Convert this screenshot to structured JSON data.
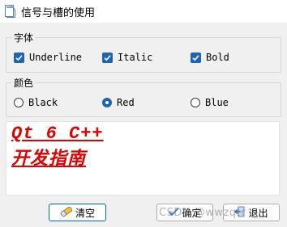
{
  "window": {
    "title": "信号与槽的使用"
  },
  "font_group": {
    "legend": "字体",
    "options": [
      {
        "label": "Underline",
        "checked": true
      },
      {
        "label": "Italic",
        "checked": true
      },
      {
        "label": "Bold",
        "checked": true
      }
    ]
  },
  "color_group": {
    "legend": "颜色",
    "options": [
      {
        "label": "Black",
        "selected": false
      },
      {
        "label": "Red",
        "selected": true
      },
      {
        "label": "Blue",
        "selected": false
      }
    ]
  },
  "editor": {
    "line1": "Qt 6 C++",
    "line2": "开发指南",
    "text_color": "#e00000"
  },
  "buttons": {
    "clear": "清空",
    "ok": "确定",
    "exit": "退出"
  },
  "watermark": "CSDN @wwzqtr",
  "colors": {
    "accent": "#1e64b0",
    "text_red": "#e00000"
  }
}
